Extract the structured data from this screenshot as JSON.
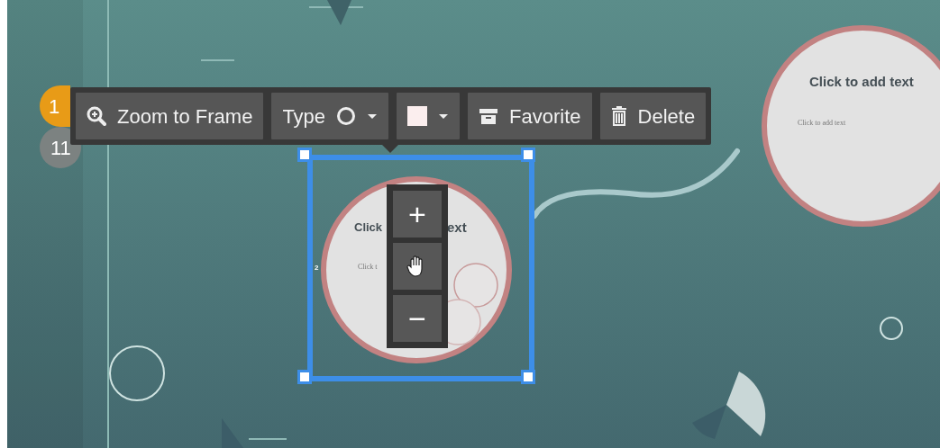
{
  "path_badges": [
    {
      "label": "1",
      "selected": true
    },
    {
      "label": "11",
      "selected": false
    }
  ],
  "toolbar": {
    "buttons": [
      {
        "kind": "zoom",
        "label": "Zoom to Frame"
      },
      {
        "kind": "type",
        "label": "Type"
      },
      {
        "kind": "color",
        "color": "#fbeeee"
      },
      {
        "kind": "favorite",
        "label": "Favorite"
      },
      {
        "kind": "delete",
        "label": "Delete"
      }
    ]
  },
  "selected_frame": {
    "number": "2",
    "title_parts": [
      "Click",
      "ext"
    ],
    "body": "Click t",
    "zoom_controls": [
      {
        "kind": "zoom_in",
        "label": "+"
      },
      {
        "kind": "pan"
      },
      {
        "kind": "zoom_out",
        "label": "−"
      }
    ]
  },
  "side_frame": {
    "title": "Click to add text",
    "body": "Click to add text"
  }
}
